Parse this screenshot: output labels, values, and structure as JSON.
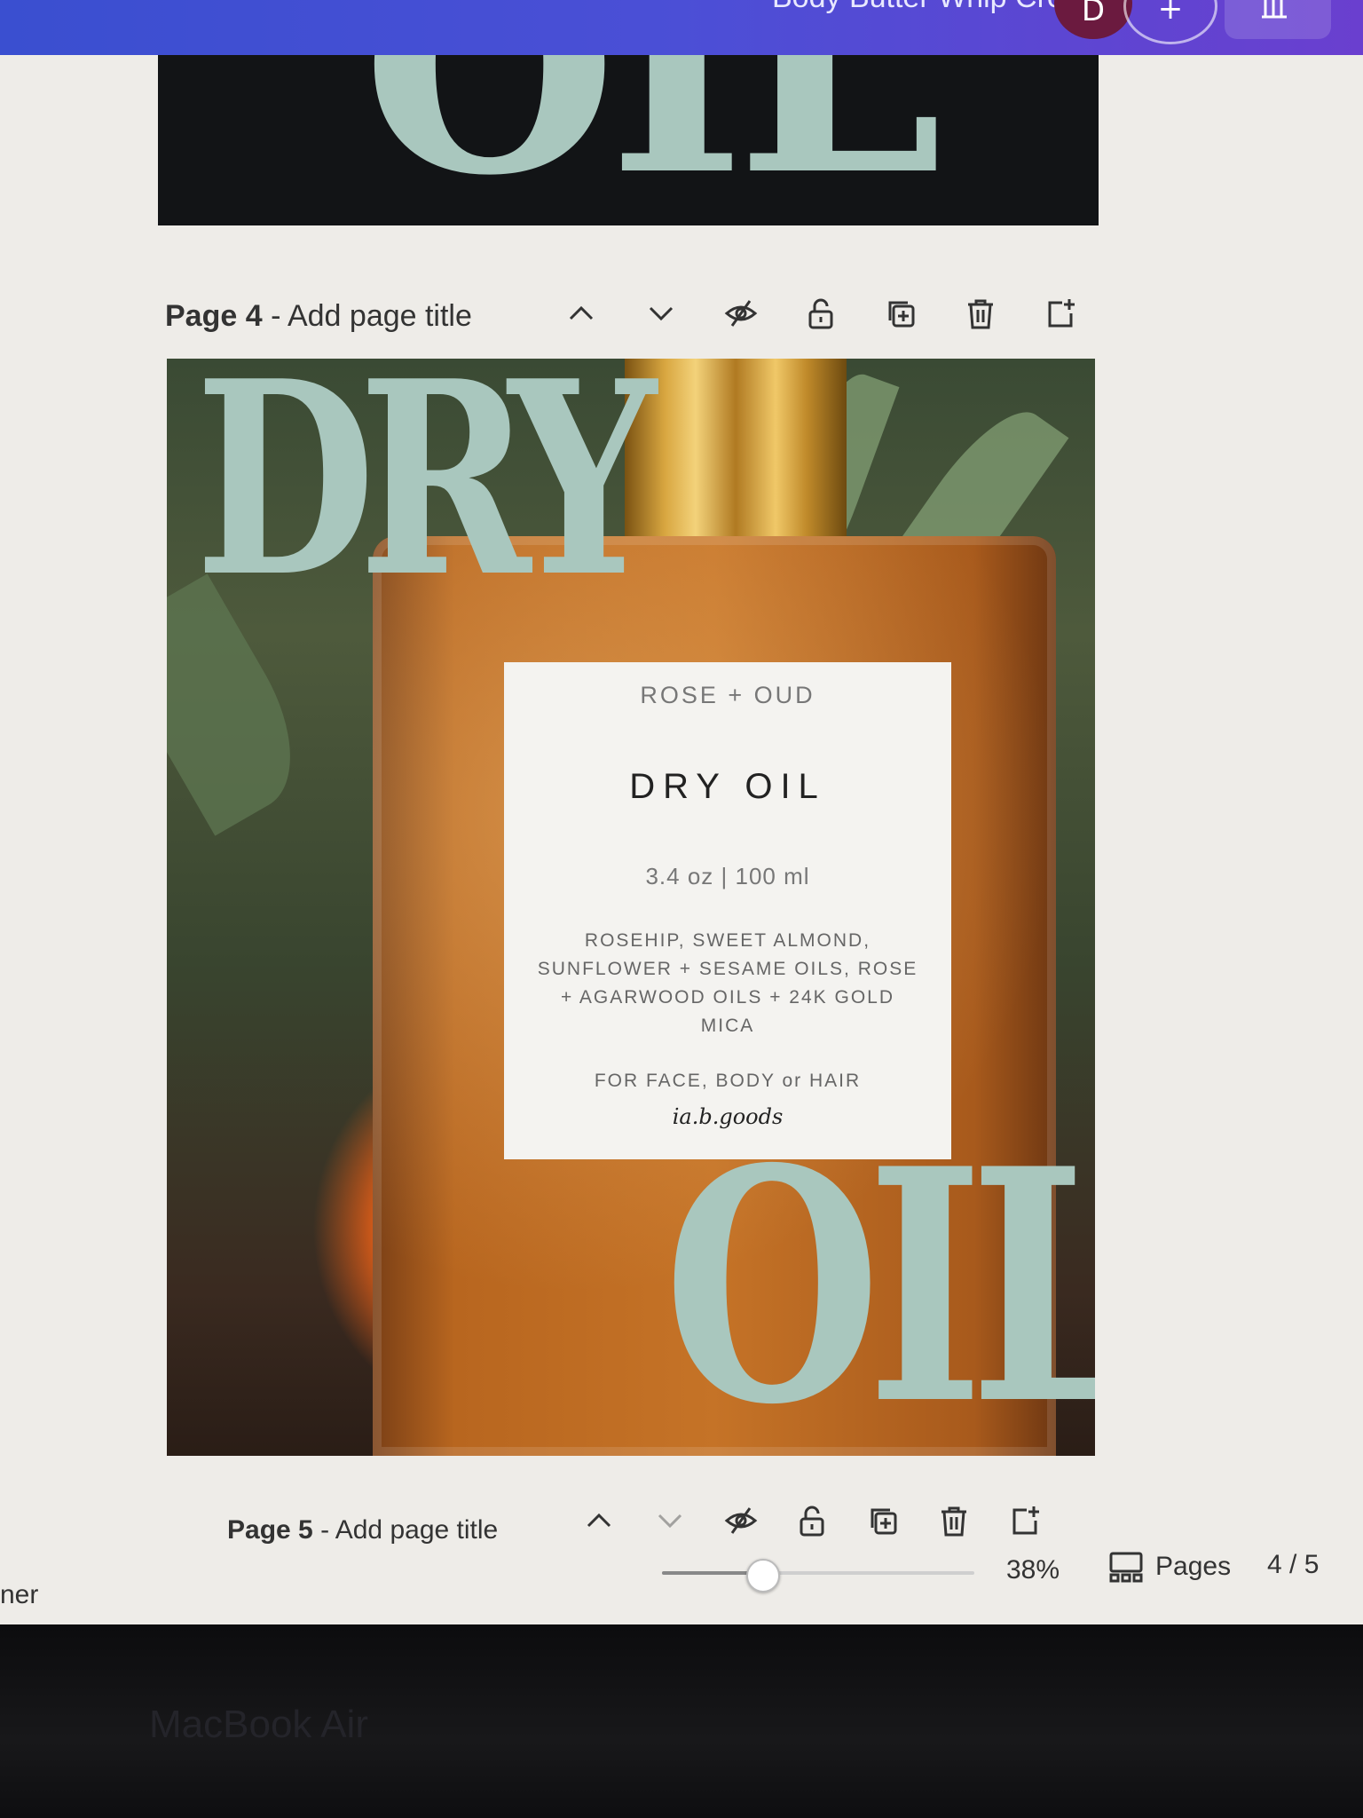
{
  "window": {
    "title_fragment": "Body Butter Whip Cream",
    "avatar_letter": "D",
    "plus_label": "+"
  },
  "page3": {
    "heading_fragment": "OIL"
  },
  "page4": {
    "label_number": "Page 4",
    "label_title": " - Add page title",
    "design": {
      "headline_top": "DRY",
      "headline_bottom": "OIL",
      "product_label": {
        "brand": "ROSE + OUD",
        "name": "DRY OIL",
        "size": "3.4 oz | 100 ml",
        "ingredients": "ROSEHIP, SWEET ALMOND, SUNFLOWER + SESAME OILS, ROSE + AGARWOOD OILS + 24K GOLD MICA",
        "usage": "FOR FACE, BODY or HAIR",
        "signature": "ia.b.goods"
      }
    }
  },
  "page5": {
    "label_number": "Page 5",
    "label_title": " - Add page title"
  },
  "footer": {
    "zoom_percent_value": 38,
    "zoom_text": "38%",
    "pages_label": "Pages",
    "page_indicator": "4 / 5",
    "left_fragment": "ner"
  },
  "bezel": {
    "device_text": "MacBook Air"
  },
  "icons": [
    "chevron-up-icon",
    "chevron-down-icon",
    "hide-icon",
    "lock-icon",
    "duplicate-icon",
    "trash-icon",
    "add-page-icon",
    "pages-grid-icon"
  ]
}
